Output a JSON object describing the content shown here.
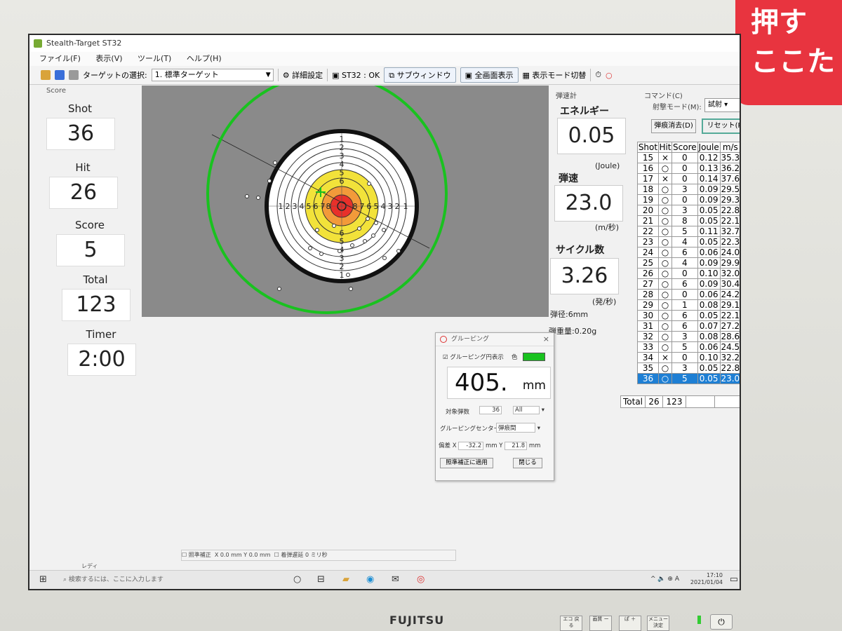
{
  "window": {
    "title": "Stealth-Target ST32"
  },
  "menu": [
    "ファイル(F)",
    "表示(V)",
    "ツール(T)",
    "ヘルプ(H)"
  ],
  "toolbar": {
    "target_select_label": "ターゲットの選択:",
    "target_select_value": "1. 標準ターゲット",
    "detail_settings": "詳細設定",
    "status": "ST32 : OK",
    "sub_window": "サブウィンドウ",
    "fullscreen": "全画面表示",
    "display_mode": "表示モード切替"
  },
  "score_panel": {
    "group_label": "Score",
    "shot_label": "Shot",
    "shot_value": "36",
    "hit_label": "Hit",
    "hit_value": "26",
    "score_label": "Score",
    "score_value": "5",
    "total_label": "Total",
    "total_value": "123",
    "timer_label": "Timer",
    "timer_value": "2:00"
  },
  "target": {
    "ring_numbers_left": [
      "1",
      "2",
      "3",
      "4",
      "5",
      "6",
      "7",
      "8"
    ],
    "ring_numbers_right": [
      "8",
      "7",
      "6",
      "5",
      "4",
      "3",
      "2",
      "1"
    ],
    "ring_numbers_top": [
      "1",
      "2",
      "3",
      "4",
      "5",
      "6"
    ],
    "ring_numbers_bottom": [
      "6",
      "5",
      "4",
      "3",
      "2",
      "1"
    ],
    "group_circle_color": "#19c21f",
    "center_mark_color": "#19c21f"
  },
  "chrono": {
    "group_label": "弾速計",
    "energy_label": "エネルギー",
    "energy_value": "0.05",
    "energy_unit": "(Joule)",
    "speed_label": "弾速",
    "speed_value": "23.0",
    "speed_unit": "(m/秒)",
    "cycle_label": "サイクル数",
    "cycle_value": "3.26",
    "cycle_unit": "(発/秒)",
    "caliber": "弾径:6mm",
    "weight": "弾重量:0.20g"
  },
  "commands": {
    "group_label": "コマンド(C)",
    "mode_label": "射撃モード(M):",
    "mode_value": "試射",
    "clear_marks": "弾痕消去(D)",
    "reset": "リセット(R)"
  },
  "shots": {
    "headers": [
      "Shot",
      "Hit",
      "Score",
      "Joule",
      "m/s"
    ],
    "rows": [
      [
        "15",
        "×",
        "0",
        "0.12",
        "35.3"
      ],
      [
        "16",
        "○",
        "0",
        "0.13",
        "36.2"
      ],
      [
        "17",
        "×",
        "0",
        "0.14",
        "37.6"
      ],
      [
        "18",
        "○",
        "3",
        "0.09",
        "29.5"
      ],
      [
        "19",
        "○",
        "0",
        "0.09",
        "29.3"
      ],
      [
        "20",
        "○",
        "3",
        "0.05",
        "22.8"
      ],
      [
        "21",
        "○",
        "8",
        "0.05",
        "22.1"
      ],
      [
        "22",
        "○",
        "5",
        "0.11",
        "32.7"
      ],
      [
        "23",
        "○",
        "4",
        "0.05",
        "22.3"
      ],
      [
        "24",
        "○",
        "6",
        "0.06",
        "24.0"
      ],
      [
        "25",
        "○",
        "4",
        "0.09",
        "29.9"
      ],
      [
        "26",
        "○",
        "0",
        "0.10",
        "32.0"
      ],
      [
        "27",
        "○",
        "6",
        "0.09",
        "30.4"
      ],
      [
        "28",
        "○",
        "0",
        "0.06",
        "24.2"
      ],
      [
        "29",
        "○",
        "1",
        "0.08",
        "29.1"
      ],
      [
        "30",
        "○",
        "6",
        "0.05",
        "22.1"
      ],
      [
        "31",
        "○",
        "6",
        "0.07",
        "27.2"
      ],
      [
        "32",
        "○",
        "3",
        "0.08",
        "28.6"
      ],
      [
        "33",
        "○",
        "5",
        "0.06",
        "24.5"
      ],
      [
        "34",
        "×",
        "0",
        "0.10",
        "32.2"
      ],
      [
        "35",
        "○",
        "3",
        "0.05",
        "22.8"
      ],
      [
        "36",
        "○",
        "5",
        "0.05",
        "23.0"
      ]
    ],
    "total": {
      "label": "Total",
      "hit": "26",
      "score": "123"
    }
  },
  "grouping": {
    "title": "グルーピング",
    "show_circle": "グルーピング円表示",
    "color_label": "色",
    "color": "#19c21f",
    "value": "405.",
    "unit": "mm",
    "target_shots_label": "対象弾数",
    "target_shots_value": "36",
    "target_shots_filter": "All",
    "center_label": "グルーピングセンター",
    "center_value": "弾痕間",
    "offset_label": "偏差",
    "offset_x_label": "X",
    "offset_x": "-32.2",
    "offset_x_unit": "mm",
    "offset_y_label": "Y",
    "offset_y": "21.8",
    "offset_y_unit": "mm",
    "apply_button": "照準補正に適用",
    "close_button": "閉じる"
  },
  "statusbar": {
    "aim_correction": "照準補正",
    "x_label": "X",
    "x_value": "0.0",
    "x_unit": "mm",
    "y_label": "Y",
    "y_value": "0.0",
    "y_unit": "mm",
    "delay_label": "着弾遅延",
    "delay_value": "0",
    "delay_unit": "ミリ秒",
    "ready": "レディ"
  },
  "taskbar": {
    "search_placeholder": "検索するには、ここに入力します",
    "time": "17:10",
    "date": "2021/01/04",
    "ime": "A"
  },
  "monitor": {
    "brand": "FUJITSU",
    "sticker_line1": "押す",
    "sticker_line2": "ここた",
    "buttons": [
      "エコ 戻る",
      "画質 ー",
      "ぱ ＋",
      "メニュー 決定"
    ]
  }
}
